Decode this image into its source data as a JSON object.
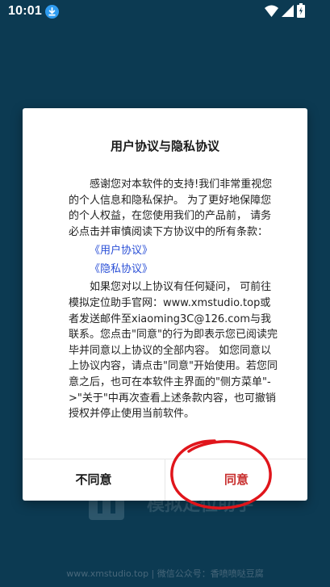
{
  "status_bar": {
    "time": "10:01"
  },
  "dialog": {
    "title": "用户协议与隐私协议",
    "intro": "感谢您对本软件的支持!我们非常重视您的个人信息和隐私保护。 为了更好地保障您的个人权益，在您使用我们的产品前， 请务必点击并审慎阅读下方协议中的所有条款：",
    "link_user_agreement": "《用户协议》",
    "link_privacy_agreement": "《隐私协议》",
    "details": "如果您对以上协议有任何疑问， 可前往模拟定位助手官网：www.xmstudio.top或者发送邮件至xiaoming3C@126.com与我联系。您点击\"同意\"的行为即表示您已阅读完毕并同意以上协议的全部内容。 如您同意以上协议内容，请点击\"同意\"开始使用。若您同意之后，也可在本软件主界面的\"侧方菜单\"->\"关于\"中再次查看上述条款内容，也可撤销授权并停止使用当前软件。",
    "disagree_label": "不同意",
    "agree_label": "同意"
  },
  "background": {
    "app_title": "模拟定位助手",
    "footer": "www.xmstudio.top | 微信公众号：香喷喷哒豆腐"
  },
  "colors": {
    "background": "#0c3a52",
    "link": "#2a4fd6",
    "agree": "#c8302f",
    "annotation": "#e0151b"
  },
  "icons": {
    "download": "download-icon",
    "wifi": "wifi-icon",
    "signal": "signal-icon",
    "battery": "battery-icon"
  }
}
